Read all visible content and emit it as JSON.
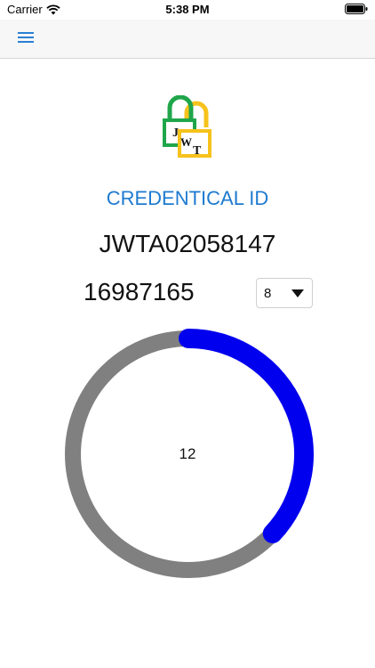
{
  "status_bar": {
    "carrier": "Carrier",
    "time": "5:38 PM"
  },
  "nav": {
    "menu_icon": "hamburger-menu-icon"
  },
  "logo": {
    "letters": [
      "J",
      "W",
      "T"
    ],
    "colors": {
      "green": "#1fa64a",
      "yellow": "#f6c21c"
    }
  },
  "credential": {
    "title": "CREDENTICAL ID",
    "id": "JWTA02058147"
  },
  "otp": {
    "code": "16987165",
    "length_select": {
      "selected": "8"
    }
  },
  "timer": {
    "remaining": "12",
    "progress_fraction": 0.37,
    "colors": {
      "track": "#808080",
      "progress": "#0000ee"
    }
  },
  "colors": {
    "accent": "#1e7ad0"
  }
}
